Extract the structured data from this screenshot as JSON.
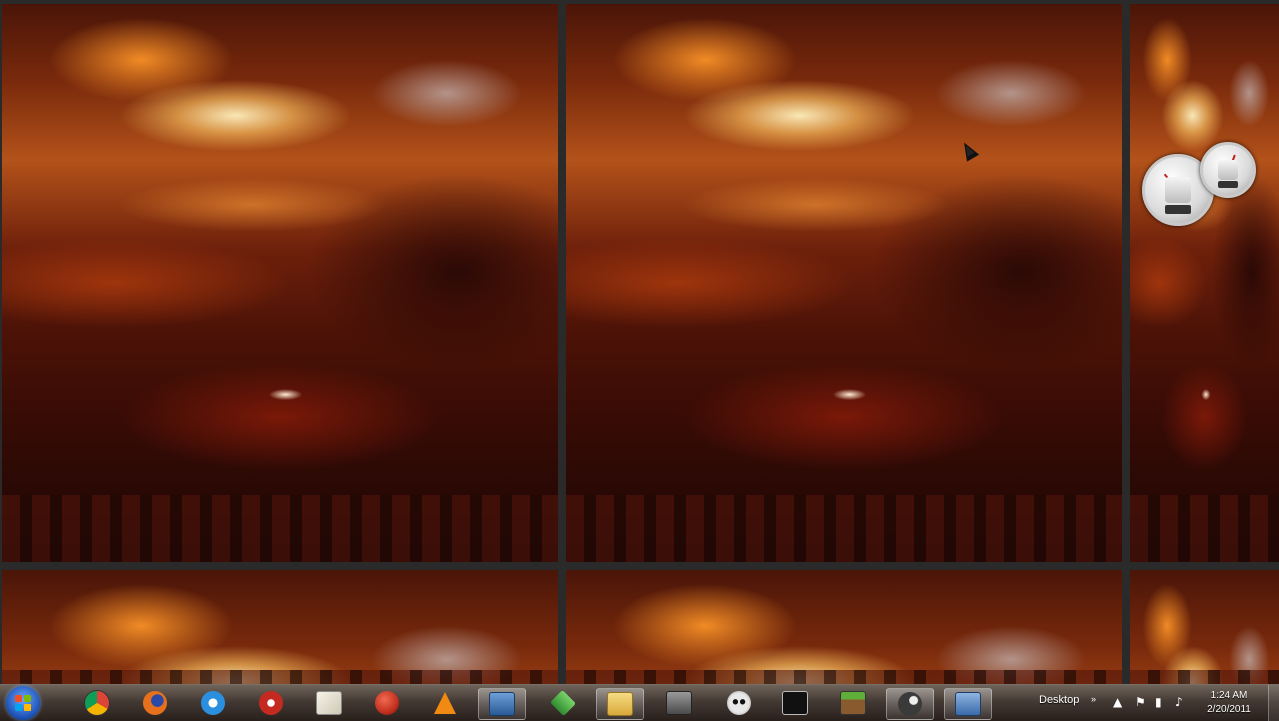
{
  "taskbar": {
    "toolbar_label": "Desktop",
    "clock": {
      "time": "1:24 AM",
      "date": "2/20/2011"
    },
    "pinned_icons": [
      {
        "name": "chrome-icon",
        "color": "#2e9b3f"
      },
      {
        "name": "firefox-icon",
        "color": "#e6701c"
      },
      {
        "name": "internet-explorer-icon",
        "color": "#2b8fe0"
      },
      {
        "name": "media-player-icon",
        "color": "#c42a1f"
      },
      {
        "name": "notepad-icon",
        "color": "#e8e4d8"
      },
      {
        "name": "red-circle-app-icon",
        "color": "#c4301f"
      },
      {
        "name": "vlc-icon",
        "color": "#f08a12"
      },
      {
        "name": "window-app-icon",
        "color": "#3a6ea5"
      },
      {
        "name": "green-stack-app-icon",
        "color": "#3caa3c"
      },
      {
        "name": "folder-icon",
        "color": "#e6c35a"
      },
      {
        "name": "emulator-app-icon",
        "color": "#6b6b6b"
      },
      {
        "name": "skull-app-icon",
        "color": "#d8d8d8"
      },
      {
        "name": "terminal-icon",
        "color": "#222222"
      },
      {
        "name": "minecraft-icon",
        "color": "#4f8f2f"
      },
      {
        "name": "steam-icon",
        "color": "#3a3a3a"
      },
      {
        "name": "explorer-window-icon",
        "color": "#4a78b0"
      }
    ]
  },
  "colors": {
    "taskbar_top": "#786e64",
    "taskbar_bottom": "#28201c",
    "wallpaper_glow": "#ffb24a"
  }
}
